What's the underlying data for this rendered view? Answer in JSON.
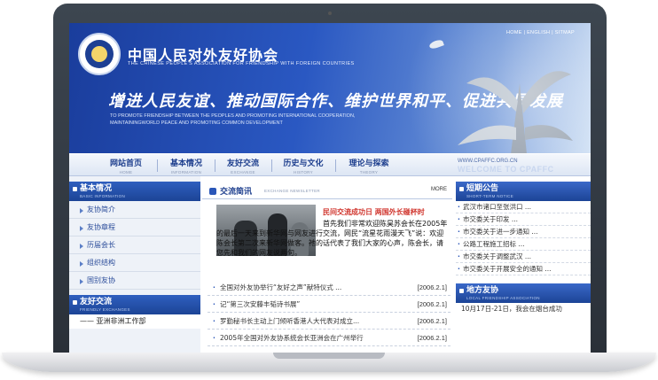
{
  "header": {
    "top_links": "HOME | ENGLISH | SITMAP",
    "org_name": "中国人民对外友好协会",
    "org_name_en": "THE CHINESE PEOPLE'S ASSOCIATION FOR FRIENDSHIP WITH FOREIGN COUNTRIES",
    "slogan": "增进人民友谊、推动国际合作、维护世界和平、促进共同发展",
    "slogan_en": "TO PROMOTE FRIENDSHIP BETWEEN THE PEOPLES AND PROMOTING INTERNATIONAL COOPERATION, MAINTAININGWORLD PEACE AND PROMOTING COMMON DEVELOPMENT"
  },
  "nav": {
    "items": [
      {
        "label": "网站首页",
        "sub": "HOME"
      },
      {
        "label": "基本情况",
        "sub": "INFORMATION"
      },
      {
        "label": "友好交流",
        "sub": "EXCHANGE"
      },
      {
        "label": "历史与文化",
        "sub": "HISTORY"
      },
      {
        "label": "理论与探索",
        "sub": "THEORY"
      }
    ],
    "url": "WWW.CPAFFC.ORG.CN",
    "welcome": "WELCOME TO CPAFFC"
  },
  "left": {
    "basic": {
      "title": "基本情况",
      "sub": "BASIC INFORMATION",
      "items": [
        "友协简介",
        "友协章程",
        "历届会长",
        "组织结构",
        "国别友协"
      ]
    },
    "exchange": {
      "title": "友好交流",
      "sub": "FRIENDLY EXCHANGES",
      "first_item": "—— 亚洲非洲工作部"
    }
  },
  "middle": {
    "title": "交流简讯",
    "sub": "EXCHANGE NEWSLETTER",
    "more": "MORE",
    "headline": "民间交流成功日 两国外长碰杯时",
    "excerpt": "首先我们非常欢迎陈昊苏会长在2005年的最后一天来到新华网与网友进行交流，网民“流星花雨漫天飞”说：欢迎陈会长第二次来新华网做客。祂的话代表了我们大家的心声，陈会长，请您先和我们的网友说两句。",
    "news": [
      {
        "title": "全国对外友协举行“友好之声”献特仪式 ...",
        "date": "[2006.2.1]"
      },
      {
        "title": "记“第三次安藤丰韬诗书展”",
        "date": "[2006.2.1]"
      },
      {
        "title": "罗勤秘书长主动上门倾听香港人大代表对成立...",
        "date": "[2006.2.1]"
      },
      {
        "title": "2005年全国对外友协系统会长亚洲会在广州举行",
        "date": "[2006.2.1]"
      }
    ]
  },
  "right": {
    "notice": {
      "title": "短期公告",
      "sub": "SHORT-TERM NOTICE",
      "items": [
        "武汉市诸口至张洪口 ...",
        "市交委关于印发 ...",
        "市交委关于进一步通知 ...",
        "公路工程施工招标 ...",
        "市交委关于调整武汉 ...",
        "市交委关于开展安全的通知 ..."
      ]
    },
    "local": {
      "title": "地方友协",
      "sub": "LOCAL FRIENDSHIP ASSOCIATION",
      "text": "10月17日-21日，我会在烟台成功"
    }
  },
  "colors": {
    "brand_blue": "#1c4496",
    "headline_red": "#d0342c"
  }
}
